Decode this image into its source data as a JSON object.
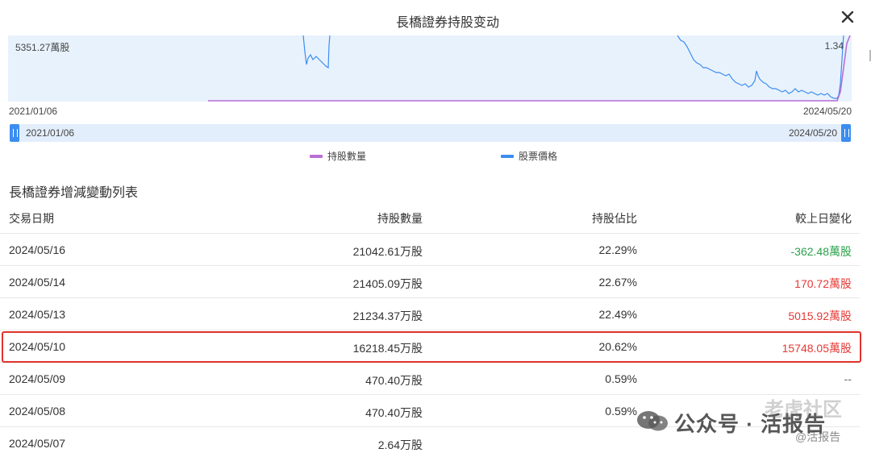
{
  "header": {
    "title": "長橋證券持股变动"
  },
  "chart": {
    "left_value": "5351.27萬股",
    "right_value": "1.34",
    "date_start": "2021/01/06",
    "date_end": "2024/05/20",
    "slider": {
      "left_label": "2021/01/06",
      "right_label": "2024/05/20"
    },
    "colors": {
      "holdings": "#b86fd6",
      "price": "#3b8df0",
      "background": "#e8f2fd"
    }
  },
  "legend": {
    "holdings": "持股數量",
    "price": "股票價格"
  },
  "table": {
    "title": "長橋證券增減變動列表",
    "columns": [
      "交易日期",
      "持股數量",
      "持股佔比",
      "較上日變化"
    ],
    "rows": [
      {
        "date": "2024/05/16",
        "qty": "21042.61万股",
        "pct": "22.29%",
        "change": "-362.48萬股",
        "trend": "neg"
      },
      {
        "date": "2024/05/14",
        "qty": "21405.09万股",
        "pct": "22.67%",
        "change": "170.72萬股",
        "trend": "pos"
      },
      {
        "date": "2024/05/13",
        "qty": "21234.37万股",
        "pct": "22.49%",
        "change": "5015.92萬股",
        "trend": "pos"
      },
      {
        "date": "2024/05/10",
        "qty": "16218.45万股",
        "pct": "20.62%",
        "change": "15748.05萬股",
        "trend": "pos"
      },
      {
        "date": "2024/05/09",
        "qty": "470.40万股",
        "pct": "0.59%",
        "change": "--",
        "trend": "none"
      },
      {
        "date": "2024/05/08",
        "qty": "470.40万股",
        "pct": "0.59%",
        "change": "",
        "trend": "none"
      },
      {
        "date": "2024/05/07",
        "qty": "2.64万股",
        "pct": "",
        "change": "",
        "trend": "none"
      }
    ]
  },
  "watermark": {
    "text": "公众号 · 活报告",
    "logo_text": "老虎社区",
    "handle": "@活报告"
  }
}
